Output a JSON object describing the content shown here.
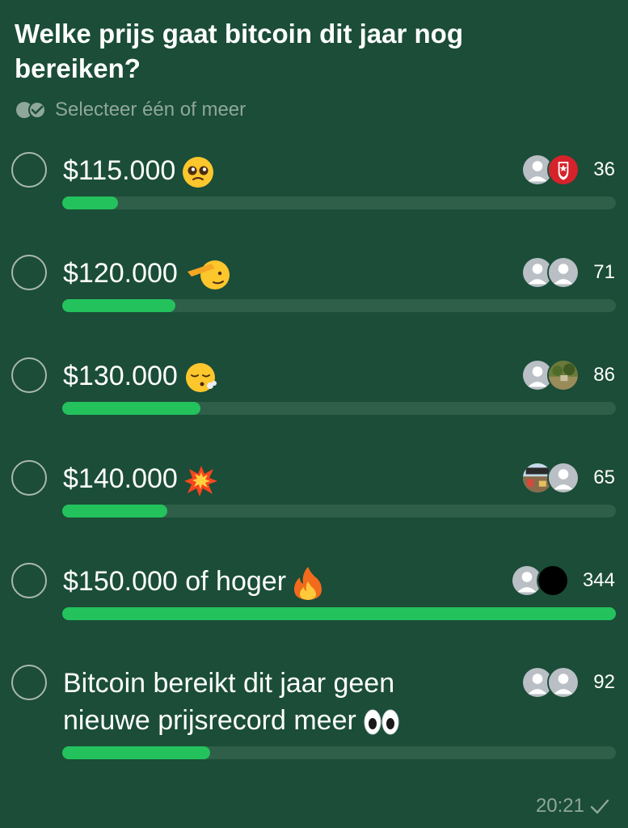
{
  "poll": {
    "question": "Welke prijs gaat bitcoin dit jaar nog bereiken?",
    "hint": "Selecteer één of meer",
    "timestamp": "20:21",
    "options": [
      {
        "label": "$115.000",
        "emoji": "pleading-face",
        "votes": "36",
        "fill": 0.1
      },
      {
        "label": "$120.000",
        "emoji": "saluting-face",
        "votes": "71",
        "fill": 0.205
      },
      {
        "label": "$130.000",
        "emoji": "exhaling-face",
        "votes": "86",
        "fill": 0.25
      },
      {
        "label": "$140.000",
        "emoji": "collision",
        "votes": "65",
        "fill": 0.19
      },
      {
        "label": "$150.000 of hoger",
        "emoji": "fire",
        "votes": "344",
        "fill": 1.0
      },
      {
        "label": "Bitcoin bereikt dit jaar geen nieuwe prijsrecord meer",
        "emoji": "eyes",
        "votes": "92",
        "fill": 0.267
      }
    ]
  },
  "colors": {
    "background": "#1b4d38",
    "bar_track": "#2f5e49",
    "bar_fill": "#23c25d",
    "muted_text": "#8fa79b"
  }
}
